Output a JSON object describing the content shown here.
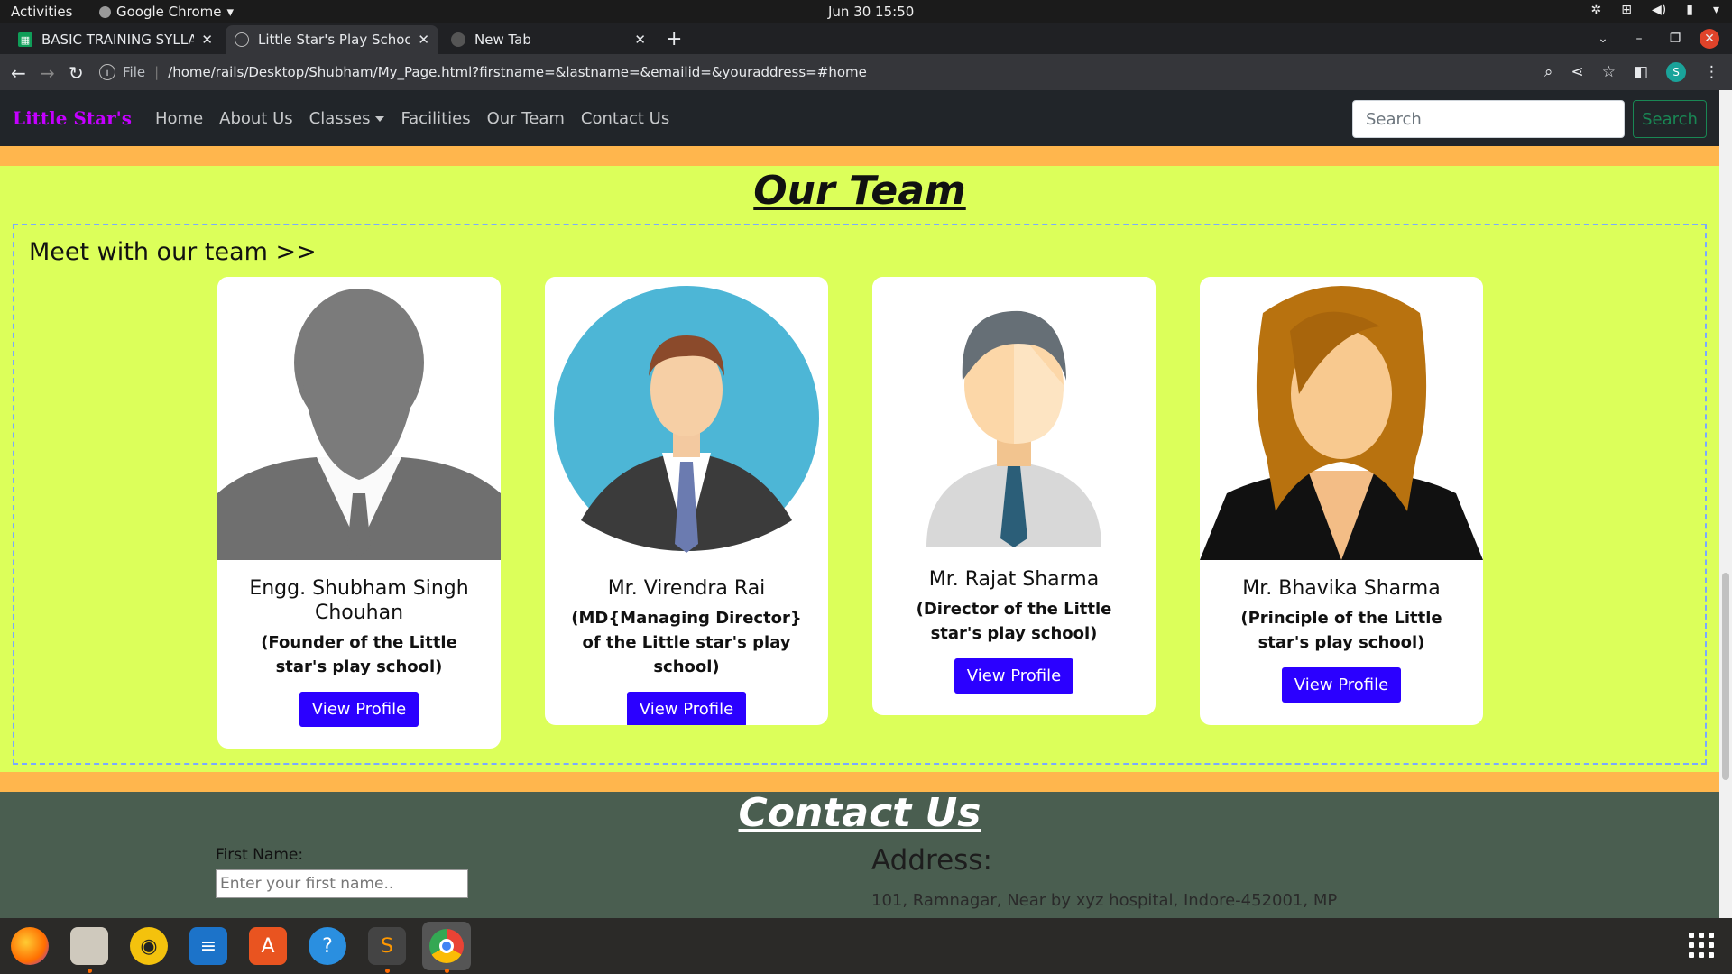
{
  "system": {
    "activities": "Activities",
    "app_name": "Google Chrome",
    "clock": "Jun 30  15:50"
  },
  "browser": {
    "tabs": [
      {
        "label": "BASIC TRAINING SYLLABUS",
        "icon": "sheets-icon"
      },
      {
        "label": "Little Star's Play School",
        "icon": "globe-icon"
      },
      {
        "label": "New Tab",
        "icon": "chrome-icon"
      }
    ],
    "url_scheme": "File",
    "url": "/home/rails/Desktop/Shubham/My_Page.html?firstname=&lastname=&emailid=&youraddress=#home",
    "profile_initial": "S"
  },
  "site": {
    "brand": "Little Star's",
    "nav": [
      "Home",
      "About Us",
      "Classes",
      "Facilities",
      "Our Team",
      "Contact Us"
    ],
    "search_placeholder": "Search",
    "search_button": "Search"
  },
  "team": {
    "title": "Our Team",
    "subtitle": "Meet with our team >>",
    "members": [
      {
        "name": "Engg. Shubham Singh Chouhan",
        "role": "(Founder of the Little star's play school)",
        "button": "View Profile"
      },
      {
        "name": "Mr. Virendra Rai",
        "role": "(MD{Managing Director} of the Little star's play school)",
        "button": "View Profile"
      },
      {
        "name": "Mr. Rajat Sharma",
        "role": "(Director of the Little star's play school)",
        "button": "View Profile"
      },
      {
        "name": "Mr. Bhavika Sharma",
        "role": "(Principle of the Little star's play school)",
        "button": "View Profile"
      }
    ]
  },
  "contact": {
    "title": "Contact Us",
    "first_name_label": "First Name:",
    "first_name_placeholder": "Enter your first name..",
    "address_heading": "Address:",
    "address_text": "101, Ramnagar, Near by xyz hospital, Indore-452001, MP"
  },
  "dock": [
    "firefox-icon",
    "files-icon",
    "rhythmbox-icon",
    "writer-icon",
    "app-center-icon",
    "help-icon",
    "sublime-icon",
    "chrome-icon"
  ],
  "colors": {
    "page_bg": "#dcff5a",
    "band": "#ffb64d",
    "brand": "#c400ff",
    "button": "#2b00ff",
    "contact_bg": "#4a5e50"
  }
}
